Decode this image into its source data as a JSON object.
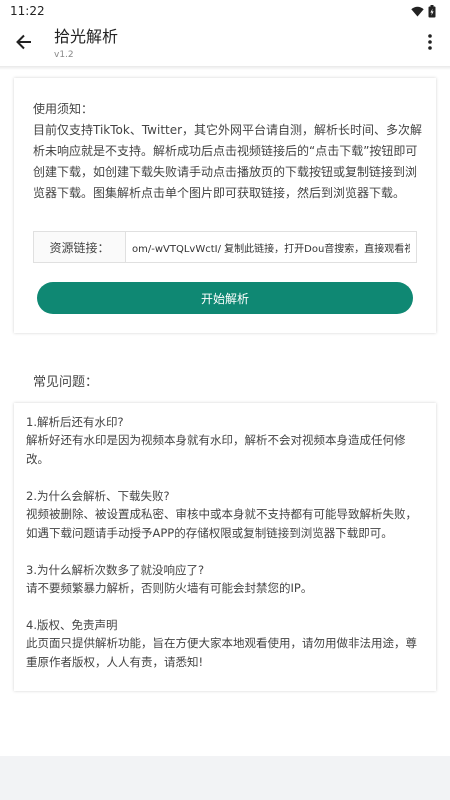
{
  "status_bar": {
    "time": "11:22",
    "wifi_icon": "wifi-icon",
    "battery_icon": "battery-icon"
  },
  "app_bar": {
    "title": "拾光解析",
    "subtitle": "v1.2",
    "back_icon": "arrow-back-icon",
    "menu_icon": "more-vert-icon"
  },
  "notice": {
    "title": "使用须知：",
    "body": "目前仅支持TikTok、Twitter，其它外网平台请自测，解析长时间、多次解析未响应就是不支持。解析成功后点击视频链接后的“点击下载”按钮即可创建下载，如创建下载失败请手动点击播放页的下载按钮或复制链接到浏览器下载。图集解析点击单个图片即可获取链接，然后到浏览器下载。"
  },
  "url_input": {
    "label": "资源链接：",
    "value": "om/-wVTQLvWctI/ 复制此链接，打开Dou音搜索，直接观看视频!"
  },
  "parse_button": {
    "label": "开始解析"
  },
  "faq": {
    "heading": "常见问题：",
    "items": [
      {
        "q": "1.解析后还有水印?",
        "a": "解析好还有水印是因为视频本身就有水印，解析不会对视频本身造成任何修改。"
      },
      {
        "q": "2.为什么会解析、下载失败?",
        "a": "视频被删除、被设置成私密、审核中或本身就不支持都有可能导致解析失败，如遇下载问题请手动授予APP的存储权限或复制链接到浏览器下载即可。"
      },
      {
        "q": "3.为什么解析次数多了就没响应了?",
        "a": "请不要频繁暴力解析，否则防火墙有可能会封禁您的IP。"
      },
      {
        "q": "4.版权、免责声明",
        "a": "此页面只提供解析功能，旨在方便大家本地观看使用，请勿用做非法用途，尊重原作者版权，人人有责，请悉知!"
      }
    ]
  },
  "colors": {
    "accent": "#0f8873",
    "bottom_bg": "#f2f3f5"
  }
}
